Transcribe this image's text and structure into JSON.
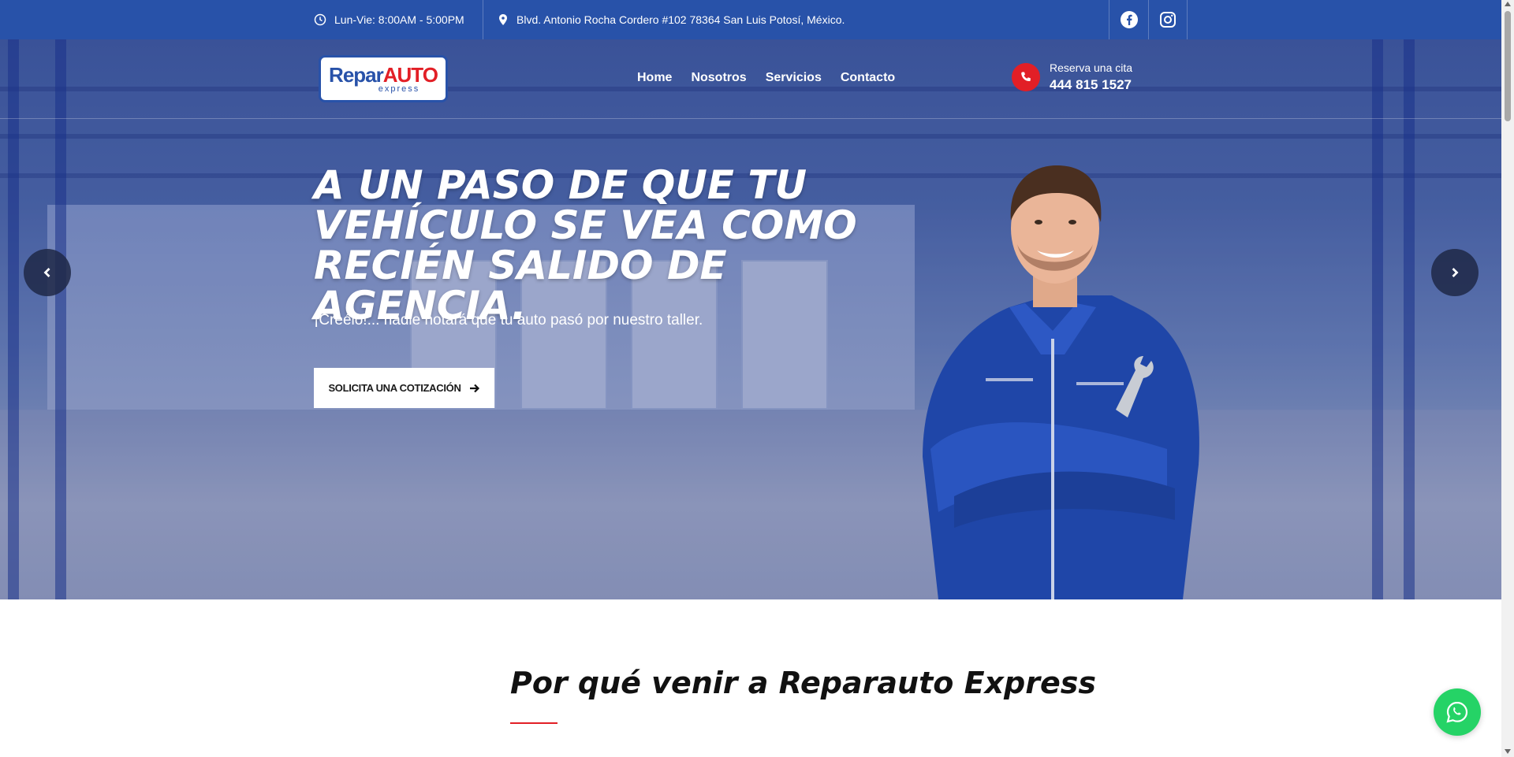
{
  "topbar": {
    "hours": "Lun-Vie: 8:00AM - 5:00PM",
    "address": "Blvd. Antonio Rocha Cordero #102 78364 San Luis Potosí, México.",
    "social": [
      "facebook-icon",
      "instagram-icon"
    ]
  },
  "header": {
    "logo_text_blue": "Repar",
    "logo_text_red": "AUTO",
    "logo_sub": "express",
    "nav": [
      "Home",
      "Nosotros",
      "Servicios",
      "Contacto"
    ],
    "book_label": "Reserva una cita",
    "book_phone": "444 815 1527"
  },
  "hero": {
    "headline": "A un paso de que tu vehículo se vea como recién salido de agencia.",
    "subhead": "¡Creélo!... nadie notará que tu auto pasó por nuestro taller.",
    "cta_label": "Solicita una cotización"
  },
  "section": {
    "title": "Por qué venir a Reparauto Express"
  },
  "colors": {
    "brand_blue": "#2852a9",
    "brand_red": "#e21f26",
    "whatsapp_green": "#25d366"
  }
}
